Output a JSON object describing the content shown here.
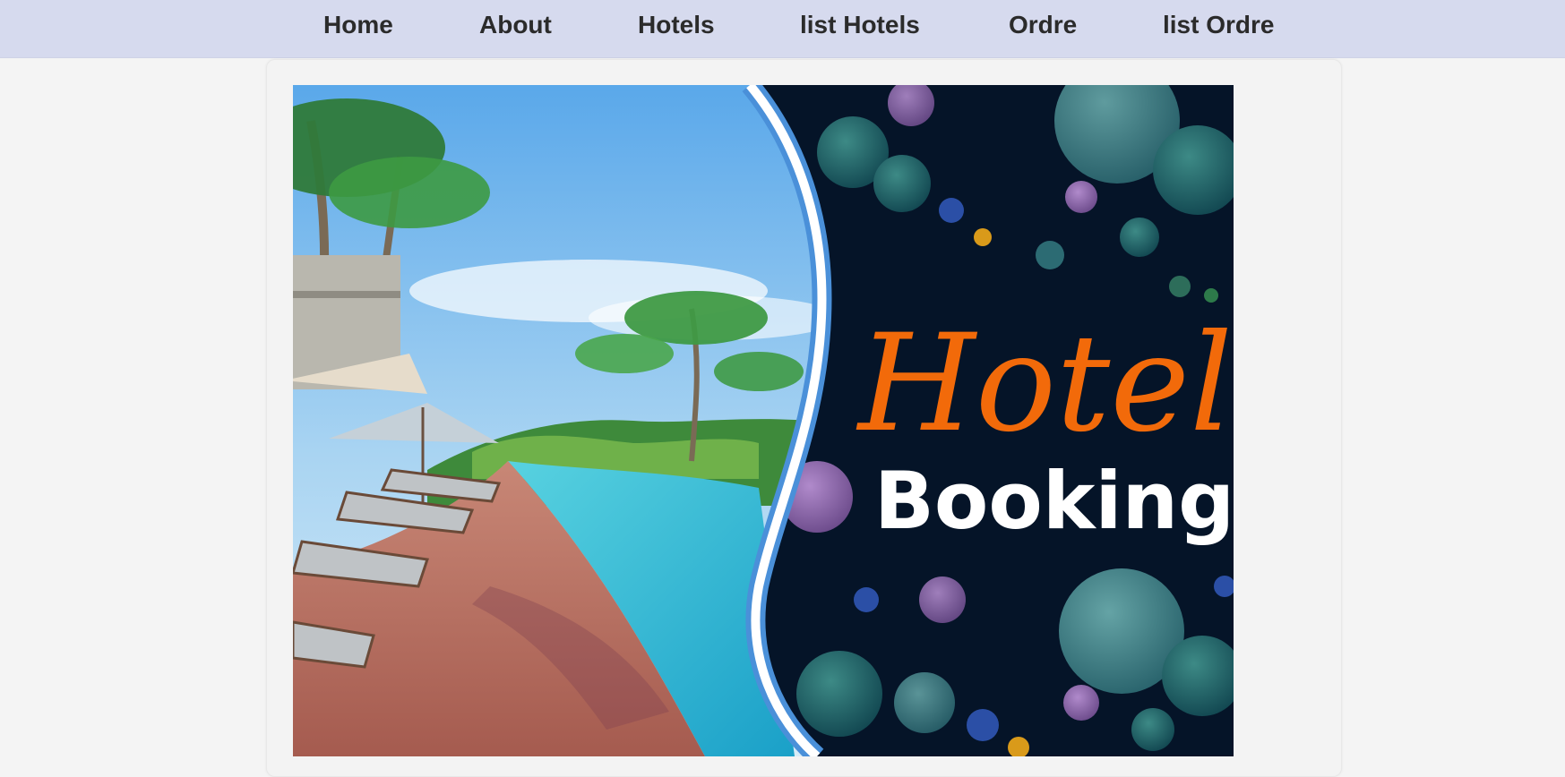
{
  "nav": {
    "items": [
      {
        "label": "Home"
      },
      {
        "label": "About"
      },
      {
        "label": "Hotels"
      },
      {
        "label": "list Hotels"
      },
      {
        "label": "Ordre"
      },
      {
        "label": "list Ordre"
      }
    ]
  },
  "hero": {
    "logo_word_1": "Hotel",
    "logo_word_2": "Booking"
  },
  "colors": {
    "nav_bg": "#d6daee",
    "page_bg": "#f4f4f4",
    "nav_text": "#2b2b2b",
    "brand_orange": "#f26a0a",
    "banner_navy": "#051428"
  }
}
